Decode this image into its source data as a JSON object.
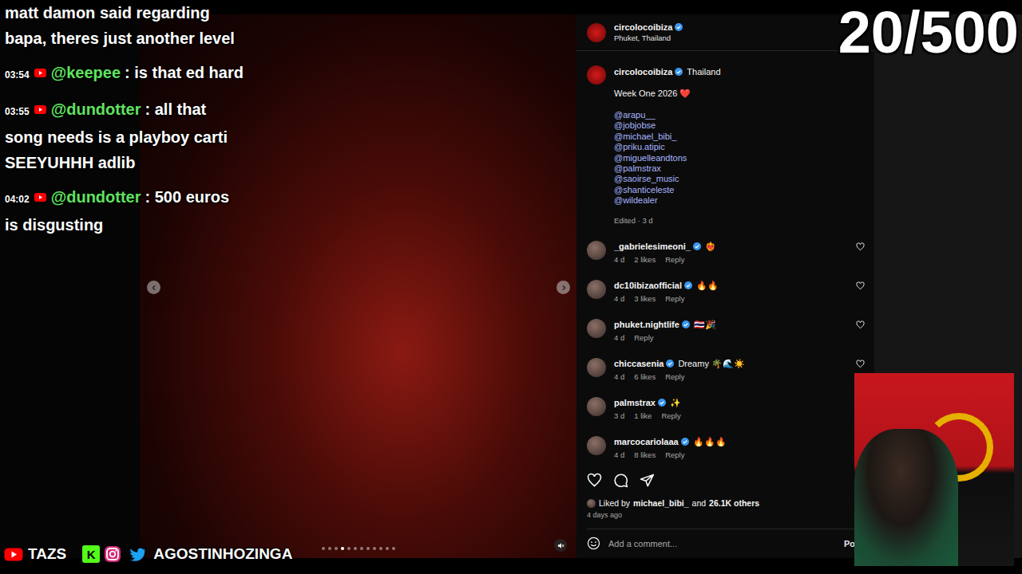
{
  "chat": {
    "leading_text": "matt damon said regarding bapa, theres just another level",
    "messages": [
      {
        "time": "03:54",
        "user": "@keepee",
        "text": ": is that ed hard"
      },
      {
        "time": "03:55",
        "user": "@dundotter",
        "text": ": all that song needs is a playboy carti SEEYUHHH adlib"
      },
      {
        "time": "04:02",
        "user": "@dundotter",
        "text": ": 500 euros is disgusting"
      }
    ]
  },
  "counter": "20/500",
  "post": {
    "account": "circolocoibiza",
    "location": "Phuket, Thailand",
    "caption_location": "Thailand",
    "caption": "Week One 2026 ❤️",
    "tags": [
      "@arapu__",
      "@jobjobse",
      "@michael_bibi_",
      "@priku.atipic",
      "@miguelleandtons",
      "@palmstrax",
      "@saoirse_music",
      "@shanticeleste",
      "@wildealer"
    ],
    "edited": "Edited · 3 d",
    "comments": [
      {
        "user": "_gabrielesimeoni_",
        "text": "❤️‍🔥",
        "age": "4 d",
        "likes": "2 likes",
        "reply": "Reply"
      },
      {
        "user": "dc10ibizaofficial",
        "text": "🔥🔥",
        "age": "4 d",
        "likes": "3 likes",
        "reply": "Reply"
      },
      {
        "user": "phuket.nightlife",
        "text": "🇹🇭🎉",
        "age": "4 d",
        "likes": "",
        "reply": "Reply"
      },
      {
        "user": "chiccasenia",
        "text": "Dreamy 🌴🌊☀️",
        "age": "4 d",
        "likes": "6 likes",
        "reply": "Reply"
      },
      {
        "user": "palmstrax",
        "text": "✨",
        "age": "3 d",
        "likes": "1 like",
        "reply": "Reply"
      },
      {
        "user": "marcocariolaaa",
        "text": "🔥🔥🔥",
        "age": "4 d",
        "likes": "8 likes",
        "reply": "Reply"
      }
    ],
    "liked_prefix": "Liked by",
    "liked_user": "michael_bibi_",
    "liked_joiner": "and",
    "liked_others": "26.1K others",
    "date": "4 days ago",
    "add_comment": "Add a comment...",
    "post_button": "Po",
    "carousel_dots": [
      {
        "selected": false
      },
      {
        "selected": false
      },
      {
        "selected": false
      },
      {
        "selected": true
      },
      {
        "selected": false
      },
      {
        "selected": false
      },
      {
        "selected": false
      },
      {
        "selected": false
      },
      {
        "selected": false
      },
      {
        "selected": false
      },
      {
        "selected": false
      },
      {
        "selected": false
      }
    ]
  },
  "socials": {
    "youtube": "TAZS",
    "kick_icon": "K",
    "handle": "AGOSTINHOZINGA"
  }
}
